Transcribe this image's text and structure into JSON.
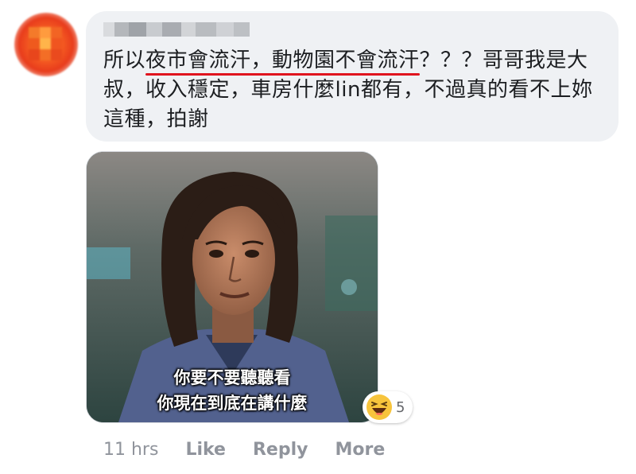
{
  "comment": {
    "text_segments": [
      {
        "text": "所以",
        "underline": false
      },
      {
        "text": "夜市會流汗，動物園不會流汗",
        "underline": true
      },
      {
        "text": "？？？哥哥我是",
        "underline": false
      },
      {
        "text": "大叔，收入穩定，",
        "underline": true
      },
      {
        "text": "車房什麼lin都有，",
        "underline": false
      },
      {
        "text": "不過真的看不上妳這種，拍謝",
        "underline": true
      }
    ]
  },
  "meme": {
    "caption_line1": "你要不要聽聽看",
    "caption_line2": "你現在到底在講什麼"
  },
  "reaction": {
    "icon": "haha-emoji-icon",
    "count": "5"
  },
  "actions": {
    "timestamp": "11 hrs",
    "like_label": "Like",
    "reply_label": "Reply",
    "more_label": "More"
  },
  "colors": {
    "bubble_bg": "#eff1f4",
    "underline": "#e0141e",
    "action_text": "#90949c"
  }
}
